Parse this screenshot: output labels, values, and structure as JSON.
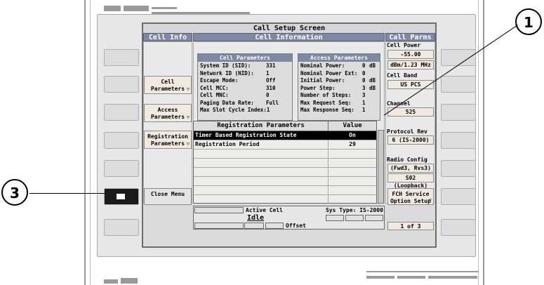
{
  "screen_title": "Call Setup Screen",
  "columns": {
    "left_header": "Cell Info",
    "center_header": "Cell Information",
    "right_header": "Call Parms"
  },
  "left_softkeys": {
    "cell_parameters": "Cell Parameters",
    "access_parameters": "Access Parameters",
    "registration_parameters": "Registration Parameters",
    "close_menu": "Close Menu"
  },
  "cell_parameters": {
    "title": "Cell Parameters",
    "rows": [
      {
        "label": "System ID (SID):",
        "value": "331"
      },
      {
        "label": "Network ID (NID):",
        "value": "1"
      },
      {
        "label": "Escape Mode:",
        "value": "Off"
      },
      {
        "label": "Cell MCC:",
        "value": "310"
      },
      {
        "label": "Cell MNC:",
        "value": "0"
      },
      {
        "label": "Paging Data Rate:",
        "value": "Full"
      },
      {
        "label": "Max Slot Cycle Index:",
        "value": "1"
      }
    ]
  },
  "access_parameters": {
    "title": "Access Parameters",
    "rows": [
      {
        "label": "Nominal Power:",
        "value": "0",
        "unit": "dB"
      },
      {
        "label": "Nominal Power Ext:",
        "value": "0",
        "unit": ""
      },
      {
        "label": "Initial Power:",
        "value": "0",
        "unit": "dB"
      },
      {
        "label": "Power Step:",
        "value": "3",
        "unit": "dB"
      },
      {
        "label": "Number of Steps:",
        "value": "3",
        "unit": ""
      },
      {
        "label": "Max Request Seq:",
        "value": "1",
        "unit": ""
      },
      {
        "label": "Max Response Seq:",
        "value": "1",
        "unit": ""
      }
    ]
  },
  "registration": {
    "title": "Registration Parameters",
    "value_header": "Value",
    "rows": [
      {
        "label": "Timer Based Registration State",
        "value": "On",
        "selected": true
      },
      {
        "label": "Registration Period",
        "value": "29",
        "selected": false
      }
    ]
  },
  "call_parms": {
    "cell_power_label": "Cell Power",
    "cell_power_value": "-55.00",
    "cell_power_unit": "dBm/1.23 MHz",
    "cell_band_label": "Cell Band",
    "cell_band_value": "US PCS",
    "channel_label": "Channel",
    "channel_value": "525",
    "protocol_rev_label": "Protocol Rev",
    "protocol_rev_value": "6 (IS-2000)",
    "radio_config_label": "Radio Config",
    "radio_config_value": "(Fwd3, Rvs3)",
    "so_value": "S02 (Loopback)",
    "fch_label": "FCH Service Option Setup",
    "page_indicator": "1 of 3"
  },
  "status_bar": {
    "active_cell_label": "Active Cell",
    "active_cell_value": "Idle",
    "sys_type": "Sys Type: IS-2000",
    "offset": "Offset"
  },
  "callouts": {
    "one": "1",
    "three": "3"
  },
  "icons": [
    "down-triangle-icon",
    "softkey-indicator-icon"
  ],
  "colors": {
    "header_bg": "#7d88a3",
    "selected_row": "#000000",
    "button_bg": "#efe9df"
  }
}
